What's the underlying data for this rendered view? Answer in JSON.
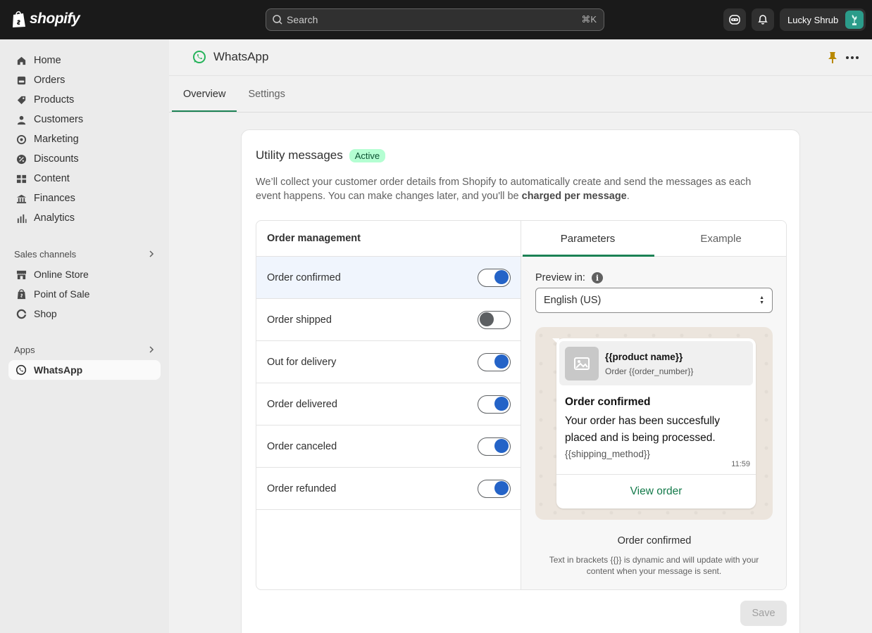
{
  "topbar": {
    "brand": "shopify",
    "search_placeholder": "Search",
    "search_shortcut": "⌘K",
    "store_name": "Lucky Shrub"
  },
  "sidebar": {
    "items": [
      {
        "label": "Home",
        "icon": "home-icon"
      },
      {
        "label": "Orders",
        "icon": "orders-icon"
      },
      {
        "label": "Products",
        "icon": "tag-icon"
      },
      {
        "label": "Customers",
        "icon": "person-icon"
      },
      {
        "label": "Marketing",
        "icon": "target-icon"
      },
      {
        "label": "Discounts",
        "icon": "discount-icon"
      },
      {
        "label": "Content",
        "icon": "content-icon"
      },
      {
        "label": "Finances",
        "icon": "bank-icon"
      },
      {
        "label": "Analytics",
        "icon": "chart-icon"
      }
    ],
    "sales_channels_label": "Sales channels",
    "sales_channels": [
      {
        "label": "Online Store",
        "icon": "store-icon"
      },
      {
        "label": "Point of Sale",
        "icon": "pos-icon"
      },
      {
        "label": "Shop",
        "icon": "shop-icon"
      }
    ],
    "apps_label": "Apps",
    "apps": [
      {
        "label": "WhatsApp",
        "icon": "whatsapp-icon",
        "active": true
      }
    ]
  },
  "header": {
    "title": "WhatsApp",
    "tabs": [
      {
        "label": "Overview",
        "active": true
      },
      {
        "label": "Settings",
        "active": false
      }
    ]
  },
  "card": {
    "title": "Utility messages",
    "badge": "Active",
    "description_main": "We’ll collect your customer order details from Shopify to automatically create and send the messages as each event happens. You can make changes later, and you'll be ",
    "description_bold": "charged per message",
    "description_end": ".",
    "left_header": "Order management",
    "rows": [
      {
        "label": "Order confirmed",
        "enabled": true,
        "selected": true
      },
      {
        "label": "Order shipped",
        "enabled": false,
        "selected": false
      },
      {
        "label": "Out for delivery",
        "enabled": true,
        "selected": false
      },
      {
        "label": "Order delivered",
        "enabled": true,
        "selected": false
      },
      {
        "label": "Order canceled",
        "enabled": true,
        "selected": false
      },
      {
        "label": "Order refunded",
        "enabled": true,
        "selected": false
      }
    ],
    "right_tabs": [
      {
        "label": "Parameters",
        "active": true
      },
      {
        "label": "Example",
        "active": false
      }
    ],
    "preview_label": "Preview in:",
    "preview_language": "English (US)",
    "message": {
      "product_name": "{{product name}}",
      "order_number": "Order {{order_number}}",
      "title": "Order confirmed",
      "body": "Your order has been succesfully placed and is being processed.",
      "variable": "{{shipping_method}}",
      "time": "11:59",
      "link": "View order"
    },
    "caption_title": "Order confirmed",
    "caption_note": "Text in brackets {{}} is dynamic and will update with your content when your message is sent.",
    "save_label": "Save"
  },
  "colors": {
    "accent_green": "#1c8255",
    "toggle_on": "#2463c7",
    "badge_bg": "#b4fed2",
    "topbar_bg": "#1a1a1a"
  }
}
